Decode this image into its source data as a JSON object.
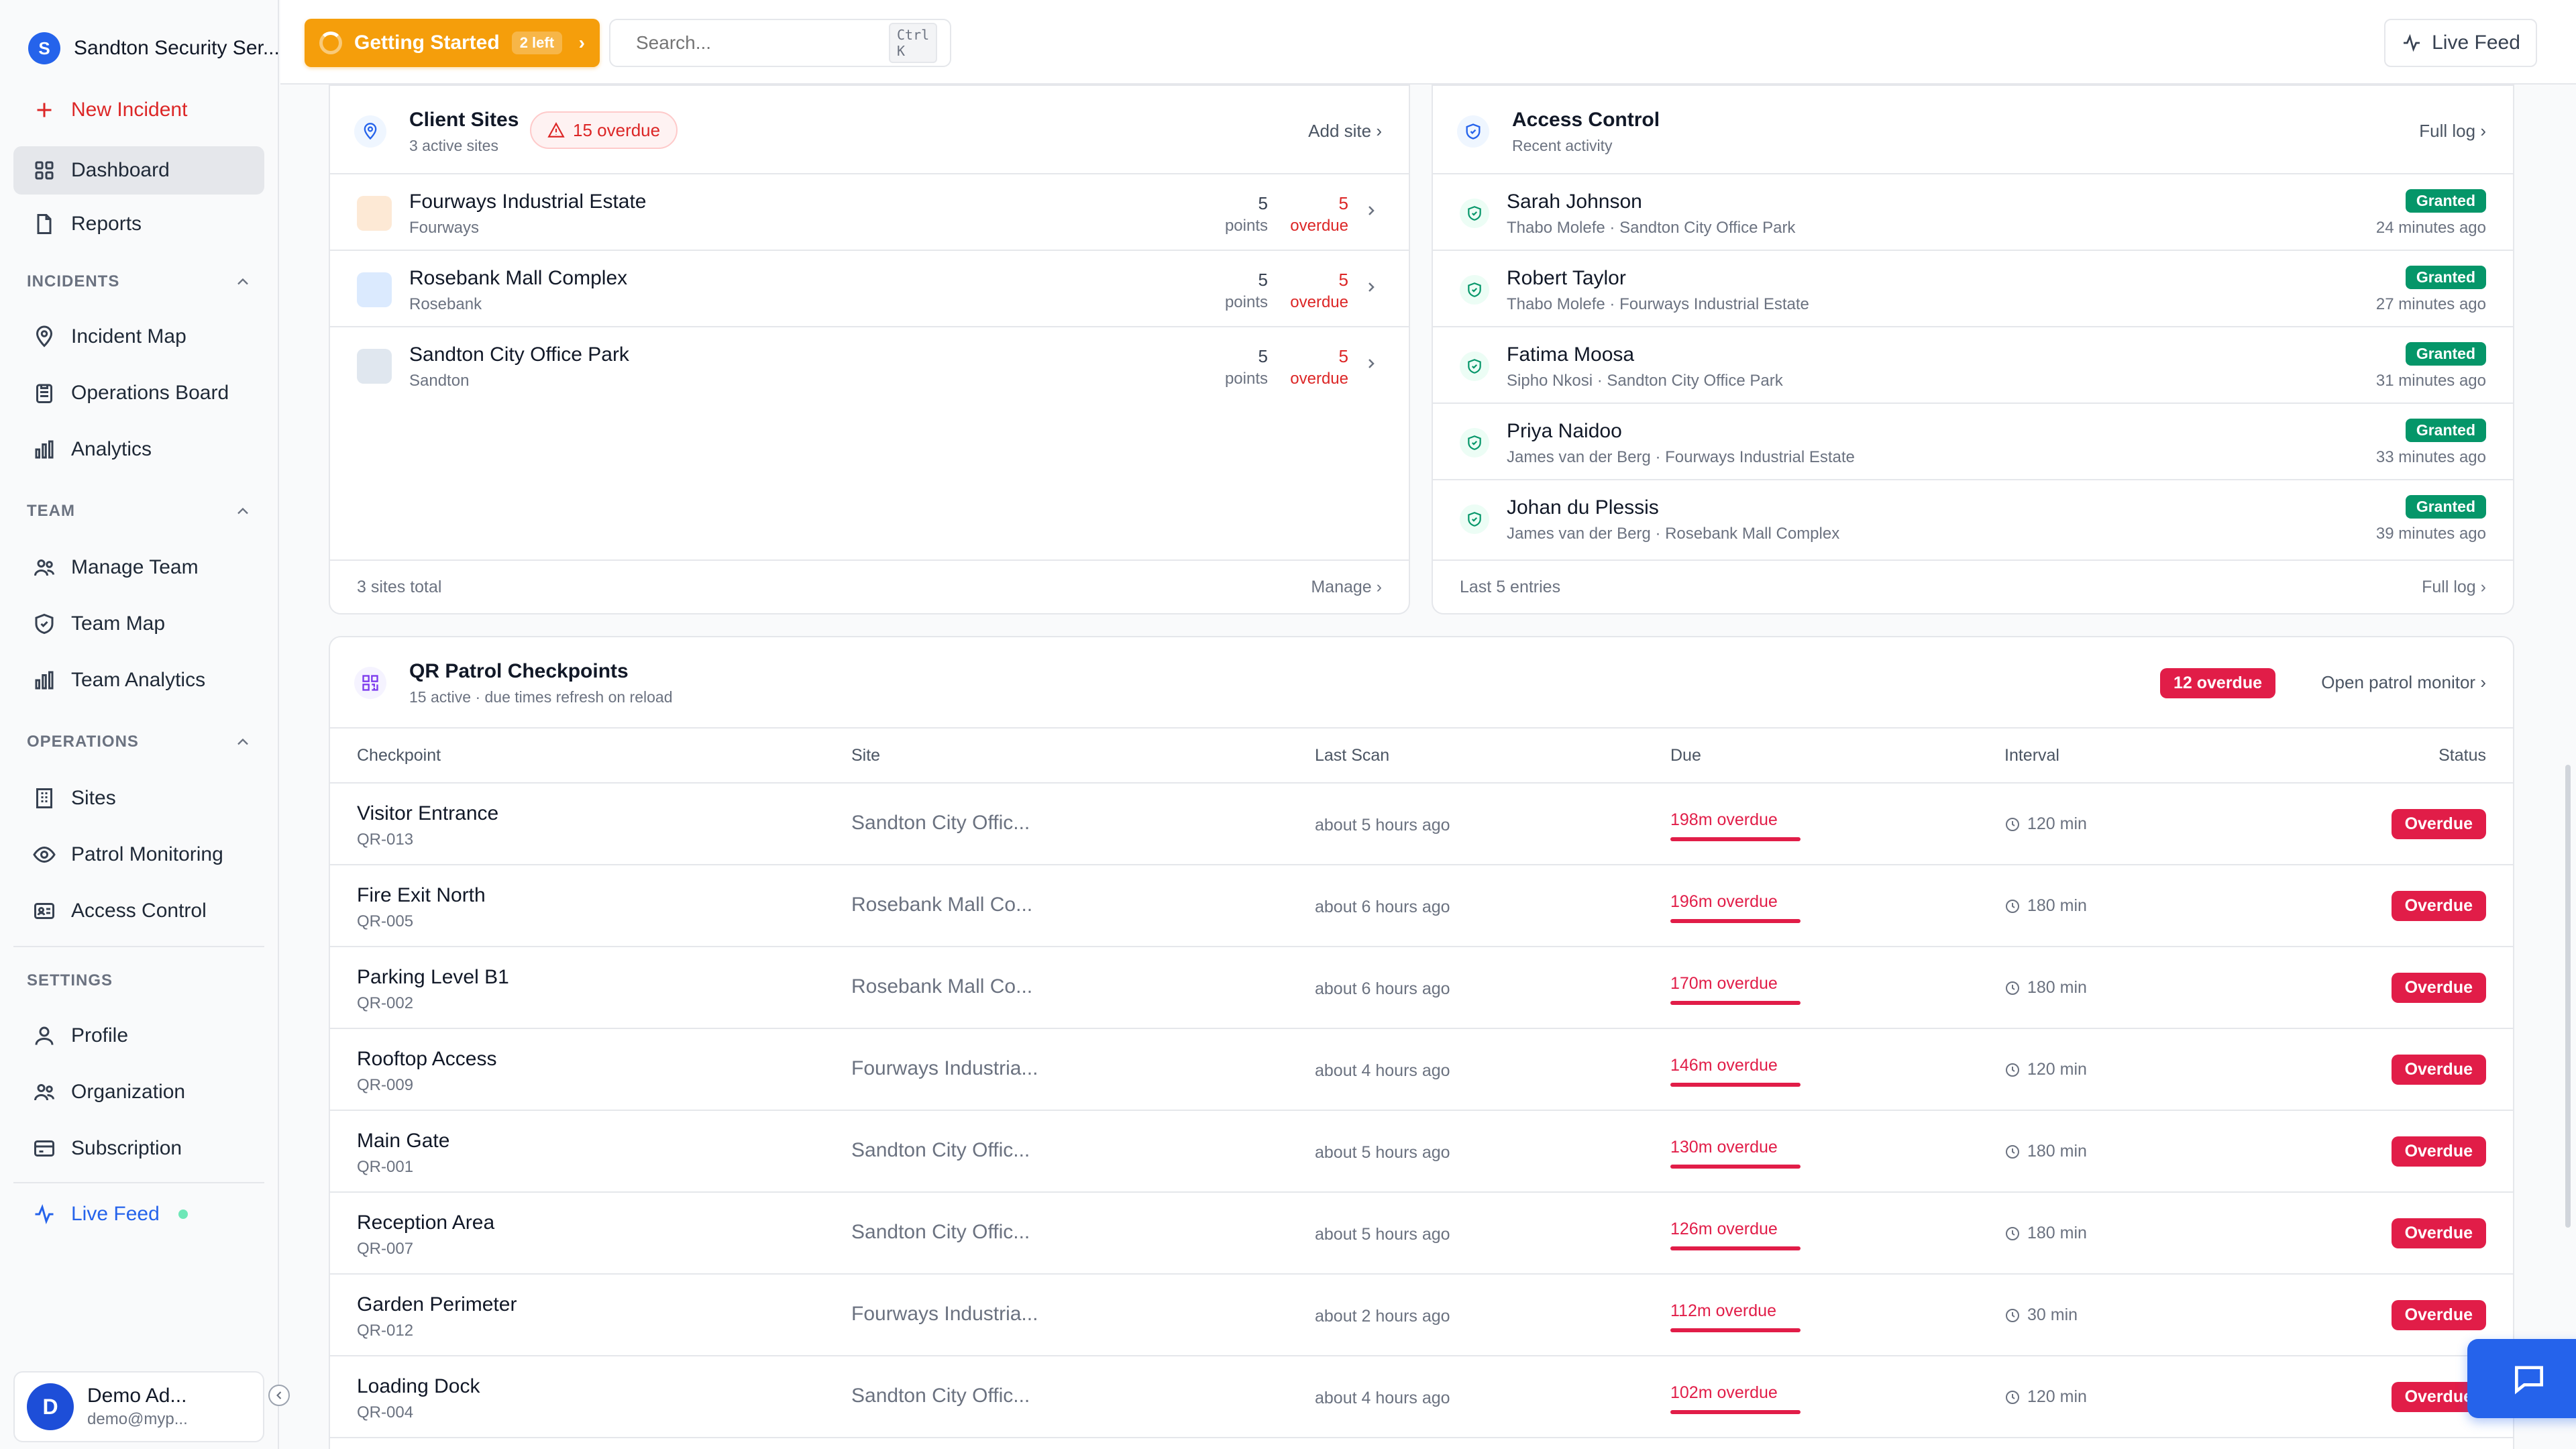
{
  "sidebar": {
    "org_initial": "S",
    "org_name": "Sandton Security Ser...",
    "new_incident": "New Incident",
    "dashboard": "Dashboard",
    "reports": "Reports",
    "incidents_label": "INCIDENTS",
    "incident_map": "Incident Map",
    "operations_board": "Operations Board",
    "analytics": "Analytics",
    "team_label": "TEAM",
    "manage_team": "Manage Team",
    "team_map": "Team Map",
    "team_analytics": "Team Analytics",
    "operations_label": "OPERATIONS",
    "sites": "Sites",
    "patrol_monitoring": "Patrol Monitoring",
    "access_control": "Access Control",
    "settings_label": "SETTINGS",
    "profile": "Profile",
    "organization": "Organization",
    "subscription": "Subscription",
    "live_feed": "Live Feed",
    "user_initial": "D",
    "user_name": "Demo Ad...",
    "user_email": "demo@myp..."
  },
  "topbar": {
    "getting_started": "Getting Started",
    "getting_started_badge": "2 left",
    "search_placeholder": "Search...",
    "search_shortcut": "Ctrl K",
    "live_feed": "Live Feed"
  },
  "client_sites": {
    "title": "Client Sites",
    "subtitle": "3 active sites",
    "overdue_pill": "15 overdue",
    "add_site": "Add site",
    "footer_total": "3 sites total",
    "footer_manage": "Manage",
    "points_label": "points",
    "overdue_label": "overdue",
    "sites": [
      {
        "name": "Fourways Industrial Estate",
        "location": "Fourways",
        "points": "5",
        "overdue": "5"
      },
      {
        "name": "Rosebank Mall Complex",
        "location": "Rosebank",
        "points": "5",
        "overdue": "5"
      },
      {
        "name": "Sandton City Office Park",
        "location": "Sandton",
        "points": "5",
        "overdue": "5"
      }
    ]
  },
  "access_control": {
    "title": "Access Control",
    "subtitle": "Recent activity",
    "full_log": "Full log",
    "footer_left": "Last 5 entries",
    "footer_right": "Full log",
    "entries": [
      {
        "name": "Sarah Johnson",
        "meta": "Thabo Molefe · Sandton City Office Park",
        "status": "Granted",
        "time": "24 minutes ago"
      },
      {
        "name": "Robert Taylor",
        "meta": "Thabo Molefe · Fourways Industrial Estate",
        "status": "Granted",
        "time": "27 minutes ago"
      },
      {
        "name": "Fatima Moosa",
        "meta": "Sipho Nkosi · Sandton City Office Park",
        "status": "Granted",
        "time": "31 minutes ago"
      },
      {
        "name": "Priya Naidoo",
        "meta": "James van der Berg · Fourways Industrial Estate",
        "status": "Granted",
        "time": "33 minutes ago"
      },
      {
        "name": "Johan du Plessis",
        "meta": "James van der Berg · Rosebank Mall Complex",
        "status": "Granted",
        "time": "39 minutes ago"
      }
    ]
  },
  "qr": {
    "title": "QR Patrol Checkpoints",
    "subtitle": "15 active · due times refresh on reload",
    "overdue_badge": "12 overdue",
    "open_monitor": "Open patrol monitor",
    "columns": {
      "checkpoint": "Checkpoint",
      "site": "Site",
      "last_scan": "Last Scan",
      "due": "Due",
      "interval": "Interval",
      "status": "Status"
    },
    "rows": [
      {
        "name": "Visitor Entrance",
        "code": "QR-013",
        "site": "Sandton City Offic...",
        "last": "about 5 hours ago",
        "due": "198m overdue",
        "interval": "120 min",
        "status": "Overdue"
      },
      {
        "name": "Fire Exit North",
        "code": "QR-005",
        "site": "Rosebank Mall Co...",
        "last": "about 6 hours ago",
        "due": "196m overdue",
        "interval": "180 min",
        "status": "Overdue"
      },
      {
        "name": "Parking Level B1",
        "code": "QR-002",
        "site": "Rosebank Mall Co...",
        "last": "about 6 hours ago",
        "due": "170m overdue",
        "interval": "180 min",
        "status": "Overdue"
      },
      {
        "name": "Rooftop Access",
        "code": "QR-009",
        "site": "Fourways Industria...",
        "last": "about 4 hours ago",
        "due": "146m overdue",
        "interval": "120 min",
        "status": "Overdue"
      },
      {
        "name": "Main Gate",
        "code": "QR-001",
        "site": "Sandton City Offic...",
        "last": "about 5 hours ago",
        "due": "130m overdue",
        "interval": "180 min",
        "status": "Overdue"
      },
      {
        "name": "Reception Area",
        "code": "QR-007",
        "site": "Sandton City Offic...",
        "last": "about 5 hours ago",
        "due": "126m overdue",
        "interval": "180 min",
        "status": "Overdue"
      },
      {
        "name": "Garden Perimeter",
        "code": "QR-012",
        "site": "Fourways Industria...",
        "last": "about 2 hours ago",
        "due": "112m overdue",
        "interval": "30 min",
        "status": "Overdue"
      },
      {
        "name": "Loading Dock",
        "code": "QR-004",
        "site": "Sandton City Offic...",
        "last": "about 4 hours ago",
        "due": "102m overdue",
        "interval": "120 min",
        "status": "Overdue"
      }
    ]
  },
  "colors": {
    "brand": "#2563eb",
    "accent_orange": "#f59e0b",
    "danger": "#e11d48",
    "success": "#059669"
  },
  "icons": [
    "plus-icon",
    "grid-icon",
    "document-icon",
    "map-pin-icon",
    "clipboard-icon",
    "bar-chart-icon",
    "users-icon",
    "shield-icon",
    "building-icon",
    "eye-icon",
    "id-card-icon",
    "user-icon",
    "credit-card-icon",
    "activity-icon",
    "search-icon",
    "qr-code-icon",
    "clock-icon",
    "chevron-right-icon",
    "chat-icon"
  ]
}
